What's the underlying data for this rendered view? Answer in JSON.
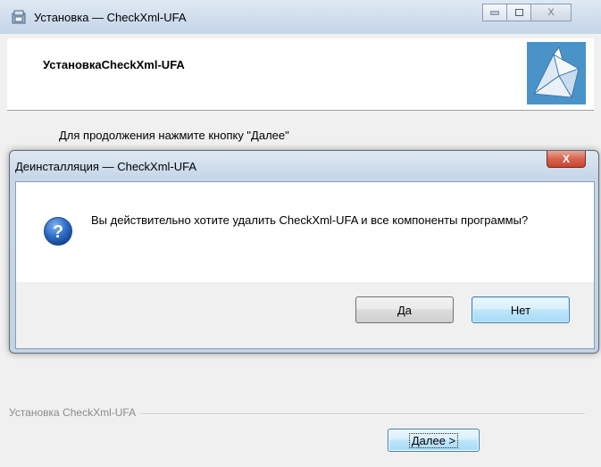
{
  "main_window": {
    "title": "Установка — CheckXml-UFA",
    "header_title": "УстановкаCheckXml-UFA",
    "instruction": "Для продолжения нажмите кнопку \"Далее\"",
    "footer_label": "Установка CheckXml-UFA",
    "next_button": "Далее >",
    "caption_buttons": {
      "minimize": "▭",
      "maximize": "□",
      "close": "X"
    }
  },
  "dialog": {
    "title": "Деинсталляция — CheckXml-UFA",
    "close_glyph": "X",
    "message": "Вы действительно хотите удалить CheckXml-UFA и все компоненты программы?",
    "yes_button": "Да",
    "no_button": "Нет",
    "icon": "question-icon"
  },
  "colors": {
    "accent_blue": "#3c7fb1",
    "close_red": "#c6462f",
    "window_bg": "#f0f0f0"
  }
}
